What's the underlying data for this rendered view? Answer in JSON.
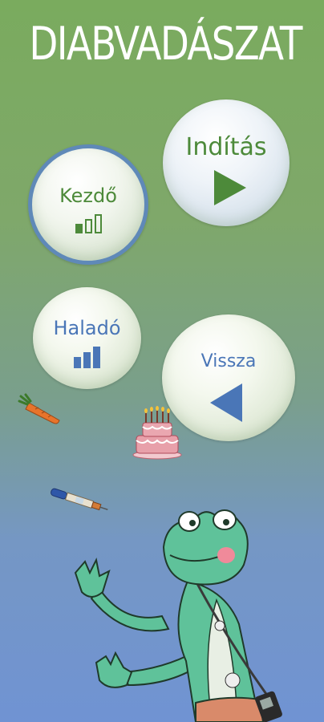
{
  "title": "DIABVADÁSZAT",
  "menu": {
    "start_label": "Indítás",
    "beginner_label": "Kezdő",
    "advanced_label": "Haladó",
    "back_label": "Vissza"
  },
  "level_indicators": {
    "beginner_level": 1,
    "advanced_level": 3,
    "max_level": 3
  },
  "colors": {
    "green_accent": "#4d8a3a",
    "blue_accent": "#4a76b7",
    "selected_ring": "#5f89b8"
  },
  "decorations": [
    "carrot-icon",
    "cake-icon",
    "insulin-pen-icon",
    "frog-character"
  ]
}
